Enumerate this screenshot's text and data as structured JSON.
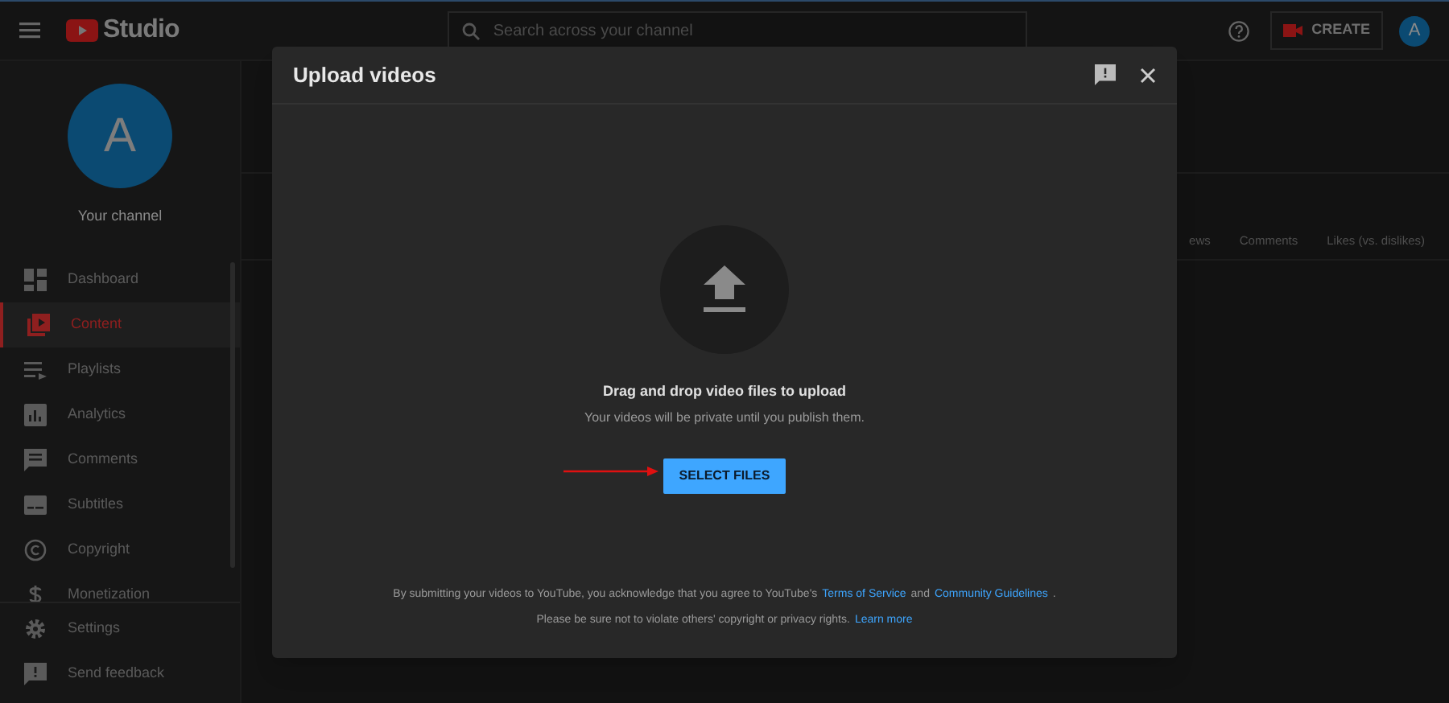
{
  "header": {
    "logo_text": "Studio",
    "search": {
      "placeholder": "Search across your channel"
    },
    "create_label": "CREATE",
    "avatar_letter": "A"
  },
  "sidebar": {
    "avatar_letter": "A",
    "channel_label": "Your channel",
    "items": [
      {
        "label": "Dashboard",
        "selected": false
      },
      {
        "label": "Content",
        "selected": true
      },
      {
        "label": "Playlists",
        "selected": false
      },
      {
        "label": "Analytics",
        "selected": false
      },
      {
        "label": "Comments",
        "selected": false
      },
      {
        "label": "Subtitles",
        "selected": false
      },
      {
        "label": "Copyright",
        "selected": false
      },
      {
        "label": "Monetization",
        "selected": false
      }
    ],
    "bottom_items": [
      {
        "label": "Settings"
      },
      {
        "label": "Send feedback"
      }
    ]
  },
  "table": {
    "columns": [
      "ews",
      "Comments",
      "Likes (vs. dislikes)"
    ]
  },
  "dialog": {
    "title": "Upload videos",
    "drop_text": "Drag and drop video files to upload",
    "sub_text": "Your videos will be private until you publish them.",
    "button": "SELECT FILES",
    "footer": [
      [
        {
          "kind": "text",
          "text": "By submitting your videos to YouTube, you acknowledge that you agree to YouTube's"
        },
        {
          "kind": "link",
          "text": "Terms of Service"
        },
        {
          "kind": "text",
          "text": "and"
        },
        {
          "kind": "link",
          "text": "Community Guidelines"
        },
        {
          "kind": "text",
          "text": "."
        }
      ],
      [
        {
          "kind": "text",
          "text": "Please be sure not to violate others' copyright or privacy rights."
        },
        {
          "kind": "link",
          "text": "Learn more"
        }
      ]
    ]
  }
}
